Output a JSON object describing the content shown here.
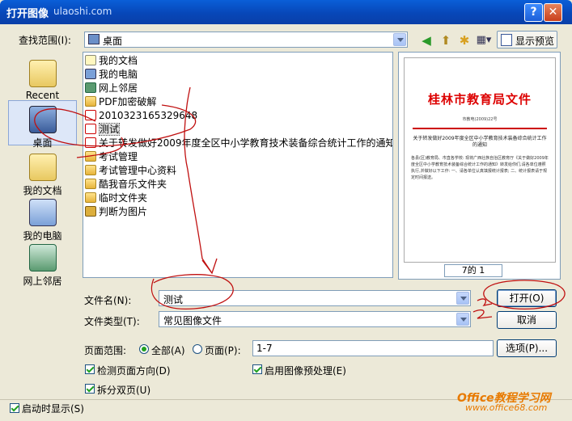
{
  "window": {
    "title": "打开图像",
    "title_suffix": "ulaoshi.com",
    "help": "?",
    "close": "✕"
  },
  "lookin": {
    "label": "查找范围(I):",
    "value": "桌面"
  },
  "toolbar": {
    "back": "◀",
    "up": "⬆",
    "newfolder": "✱",
    "views": "▦▾",
    "preview_label": "显示预览"
  },
  "places": [
    {
      "label": "Recent",
      "icon": "recent-folder-icon",
      "color": "#e8c860"
    },
    {
      "label": "桌面",
      "icon": "desktop-icon",
      "color": "#5577aa"
    },
    {
      "label": "我的文档",
      "icon": "my-documents-icon",
      "color": "#e8c860"
    },
    {
      "label": "我的电脑",
      "icon": "my-computer-icon",
      "color": "#7aa0d8"
    },
    {
      "label": "网上邻居",
      "icon": "network-icon",
      "color": "#5a9a70"
    }
  ],
  "files": [
    {
      "name": "我的文档",
      "icon": "doc"
    },
    {
      "name": "我的电脑",
      "icon": "comp"
    },
    {
      "name": "网上邻居",
      "icon": "net"
    },
    {
      "name": "PDF加密破解",
      "icon": "folder"
    },
    {
      "name": "2010323165329648",
      "icon": "pdf"
    },
    {
      "name": "测试",
      "icon": "pdf"
    },
    {
      "name": "关于转发做好2009年度全区中小学教育技术装备综合统计工作的通知",
      "icon": "pdf"
    },
    {
      "name": "考试管理",
      "icon": "folder"
    },
    {
      "name": "考试管理中心资料",
      "icon": "folder"
    },
    {
      "name": "酷我音乐文件夹",
      "icon": "folder"
    },
    {
      "name": "临时文件夹",
      "icon": "folder"
    },
    {
      "name": "判断为图片",
      "icon": "img"
    }
  ],
  "preview": {
    "doc_title": "桂林市教育局文件",
    "doc_ref": "市教电(2009)22号",
    "doc_heading": "关于转发做好2009年度全区中小学教育技术装备综合统计工作的通知",
    "doc_body": "各县(区)教育局、市直各学校:  现将广西壮族自治区教育厅《关于做好2009年度全区中小学教育技术装备综合统计工作的通知》转发给你们,请各单位遵照执行,并做好以下工作:  一、请各单位认真填报统计报表;  二、统计报表请于规定时间报送。",
    "page_counter": "7的 1"
  },
  "filename": {
    "label": "文件名(N):",
    "value": "测试"
  },
  "filetype": {
    "label": "文件类型(T):",
    "value": "常见图像文件"
  },
  "buttons": {
    "open": "打开(O)",
    "cancel": "取消",
    "options": "选项(P)..."
  },
  "pagerange": {
    "label": "页面范围:",
    "all": "全部(A)",
    "pages": "页面(P):",
    "value": "1-7"
  },
  "checks": {
    "detect_orientation": "检测页面方向(D)",
    "enable_preprocess": "启用图像预处理(E)",
    "split_pages": "拆分双页(U)",
    "show_on_start": "启动时显示(S)"
  },
  "watermark": {
    "brand": "Office教程学习网",
    "url": "www.office68.com"
  }
}
